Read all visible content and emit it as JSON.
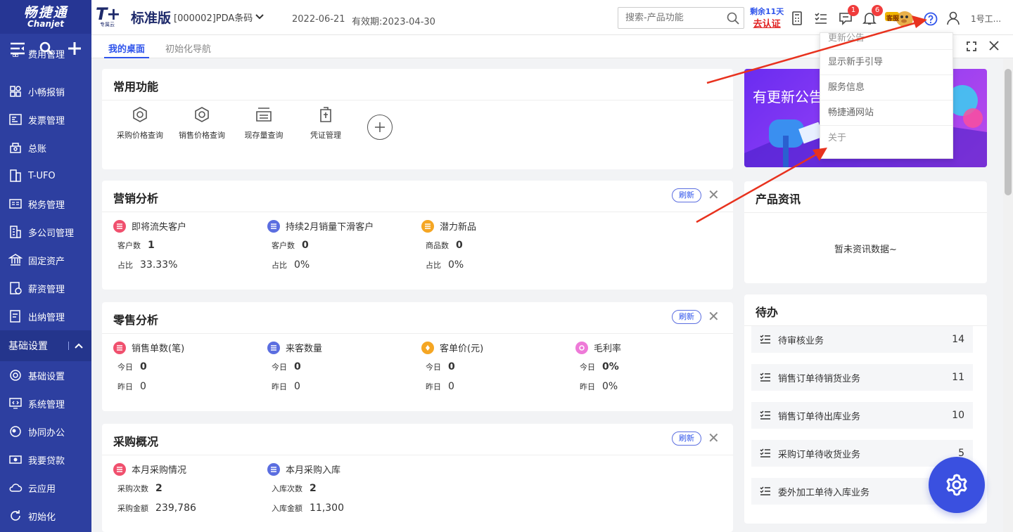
{
  "brand": {
    "cn": "畅捷通",
    "en": "Chanjet"
  },
  "topbar": {
    "product_logo": "T+",
    "product_sub": "专属云",
    "edition": "标准版",
    "account": "[000002]PDA条码",
    "date": "2022-06-21",
    "validity": "有效期:2023-04-30",
    "search_placeholder": "搜索-产品功能",
    "remain_days": "剩余11天",
    "certify_link": "去认证",
    "message_badge": "1",
    "notify_badge": "6",
    "service_label": "客服",
    "user_name": "1号工..."
  },
  "sidebar": {
    "items": [
      {
        "label": "费用管理",
        "icon": "grid-icon"
      },
      {
        "label": "小畅报销",
        "icon": "grid-icon"
      },
      {
        "label": "发票管理",
        "icon": "invoice-icon"
      },
      {
        "label": "总账",
        "icon": "ledger-icon"
      },
      {
        "label": "T-UFO",
        "icon": "report-icon"
      },
      {
        "label": "税务管理",
        "icon": "tax-icon"
      },
      {
        "label": "多公司管理",
        "icon": "company-icon"
      },
      {
        "label": "固定资产",
        "icon": "bank-icon"
      },
      {
        "label": "薪资管理",
        "icon": "salary-icon"
      },
      {
        "label": "出纳管理",
        "icon": "cashier-icon"
      }
    ],
    "group": {
      "label": "基础设置"
    },
    "items2": [
      {
        "label": "基础设置",
        "icon": "settings-icon"
      },
      {
        "label": "系统管理",
        "icon": "system-icon"
      },
      {
        "label": "协同办公",
        "icon": "collab-icon"
      },
      {
        "label": "我要贷款",
        "icon": "loan-icon"
      },
      {
        "label": "云应用",
        "icon": "cloud-icon"
      },
      {
        "label": "初始化",
        "icon": "init-icon"
      }
    ]
  },
  "tabs": [
    {
      "label": "我的桌面",
      "active": true
    },
    {
      "label": "初始化导航",
      "active": false
    }
  ],
  "common": {
    "title": "常用功能",
    "functions": [
      "采购价格查询",
      "销售价格查询",
      "现存量查询",
      "凭证管理"
    ]
  },
  "marketing": {
    "title": "营销分析",
    "refresh": "刷新",
    "metrics": [
      {
        "title": "即将流失客户",
        "color": "#f0506e",
        "k1": "客户数",
        "v1": "1",
        "k2": "占比",
        "v2": "33.33%"
      },
      {
        "title": "持续2月销量下滑客户",
        "color": "#5b6ee0",
        "k1": "客户数",
        "v1": "0",
        "k2": "占比",
        "v2": "0%"
      },
      {
        "title": "潜力新品",
        "color": "#f5a623",
        "k1": "商品数",
        "v1": "0",
        "k2": "占比",
        "v2": "0%"
      }
    ]
  },
  "retail": {
    "title": "零售分析",
    "refresh": "刷新",
    "metrics": [
      {
        "title": "销售单数(笔)",
        "color": "#f0506e",
        "k1": "今日",
        "v1": "0",
        "k2": "昨日",
        "v2": "0"
      },
      {
        "title": "来客数量",
        "color": "#5b6ee0",
        "k1": "今日",
        "v1": "0",
        "k2": "昨日",
        "v2": "0"
      },
      {
        "title": "客单价(元)",
        "color": "#f5a623",
        "k1": "今日",
        "v1": "0",
        "k2": "昨日",
        "v2": "0"
      },
      {
        "title": "毛利率",
        "color": "#ee7ad8",
        "k1": "今日",
        "v1": "0%",
        "k2": "昨日",
        "v2": "0%"
      }
    ]
  },
  "purchase": {
    "title": "采购概况",
    "refresh": "刷新",
    "metrics": [
      {
        "title": "本月采购情况",
        "color": "#f0506e",
        "k1": "采购次数",
        "v1": "2",
        "k2": "采购金额",
        "v2": "239,786"
      },
      {
        "title": "本月采购入库",
        "color": "#5b6ee0",
        "k1": "入库次数",
        "v1": "2",
        "k2": "入库金额",
        "v2": "11,300"
      }
    ]
  },
  "banner": {
    "text": "有更新公告"
  },
  "news": {
    "title": "产品资讯",
    "empty": "暂未资讯数据~"
  },
  "todo": {
    "title": "待办",
    "items": [
      {
        "label": "待审核业务",
        "count": "14"
      },
      {
        "label": "销售订单待销货业务",
        "count": "11"
      },
      {
        "label": "销售订单待出库业务",
        "count": "10"
      },
      {
        "label": "采购订单待收货业务",
        "count": "5"
      },
      {
        "label": "委外加工单待入库业务",
        "count": ""
      }
    ]
  },
  "dropdown": {
    "items": [
      "更新公告",
      "显示新手引导",
      "服务信息",
      "畅捷通网站",
      "关于"
    ]
  }
}
